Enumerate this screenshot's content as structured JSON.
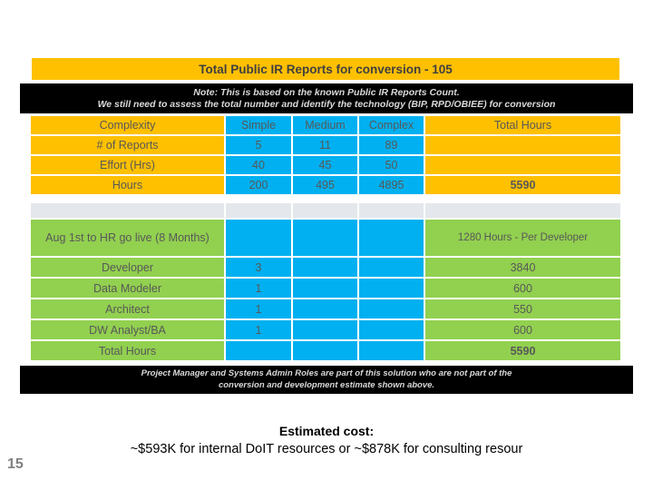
{
  "slide": {
    "number": "15",
    "title": "Total Public IR Reports for conversion - 105",
    "note_lines": [
      "Note: This is based on the known Public  IR Reports Count.",
      "We still need to assess the total number and identify the technology (BIP, RPD/OBIEE) for conversion"
    ],
    "footer_lines": [
      "Project Manager and Systems Admin Roles are part of this solution who are not part of the",
      "conversion and development estimate shown above."
    ],
    "cost_title": "Estimated cost:",
    "cost_detail": "~$593K for internal DoIT resources or ~$878K for consulting resour"
  },
  "colors": {
    "yellow": "#FFC000",
    "blue": "#00B0F0",
    "green": "#92D050",
    "black": "#000000",
    "gray_spacer": "#E4E7EC",
    "text_gray": "#585858"
  },
  "complexity_table": {
    "header": [
      "Complexity",
      "Simple",
      "Medium",
      "Complex",
      "Total Hours"
    ],
    "rows": [
      {
        "label": "# of Reports",
        "simple": "5",
        "medium": "11",
        "complex": "89",
        "total": ""
      },
      {
        "label": "Effort (Hrs)",
        "simple": "40",
        "medium": "45",
        "complex": "50",
        "total": ""
      },
      {
        "label": "Hours",
        "simple": "200",
        "medium": "495",
        "complex": "4895",
        "total": "5590"
      }
    ]
  },
  "resources_table": {
    "rows": [
      {
        "label": "Aug 1st to HR go live (8 Months)",
        "c2": "",
        "c3": "",
        "c4": "",
        "total": "1280 Hours - Per Developer"
      },
      {
        "label": "Developer",
        "c2": "3",
        "c3": "",
        "c4": "",
        "total": "3840"
      },
      {
        "label": "Data Modeler",
        "c2": "1",
        "c3": "",
        "c4": "",
        "total": "600"
      },
      {
        "label": "Architect",
        "c2": "1",
        "c3": "",
        "c4": "",
        "total": "550"
      },
      {
        "label": "DW Analyst/BA",
        "c2": "1",
        "c3": "",
        "c4": "",
        "total": "600"
      },
      {
        "label": "Total Hours",
        "c2": "",
        "c3": "",
        "c4": "",
        "total": "5590"
      }
    ]
  }
}
